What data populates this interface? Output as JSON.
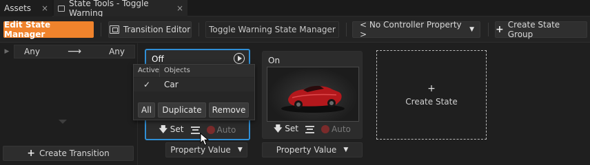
{
  "tabs": [
    {
      "label": "Assets",
      "close": "×"
    },
    {
      "label": "State Tools - Toggle Warning",
      "close": "×"
    }
  ],
  "toolbar": {
    "edit_state_manager": "Edit State Manager",
    "transition_editor": "Transition Editor",
    "state_manager_name": "Toggle Warning State Manager",
    "controller_property": "< No Controller Property >",
    "create_state_group": "Create State Group"
  },
  "transitions": {
    "from": "Any",
    "to": "Any",
    "create_transition": "Create Transition"
  },
  "states": [
    {
      "name": "Off",
      "set_label": "Set",
      "auto_label": "Auto",
      "property_value": "Property Value"
    },
    {
      "name": "On",
      "set_label": "Set",
      "auto_label": "Auto",
      "property_value": "Property Value"
    }
  ],
  "create_state": "Create State",
  "popup": {
    "col_active": "Active",
    "col_objects": "Objects",
    "rows": [
      {
        "active": "✓",
        "object": "Car"
      }
    ],
    "btn_all": "All",
    "btn_duplicate": "Duplicate",
    "btn_remove": "Remove"
  },
  "colors": {
    "accent_orange": "#f0832c",
    "selection_blue": "#2f8fd6",
    "car_red": "#b3181c"
  }
}
